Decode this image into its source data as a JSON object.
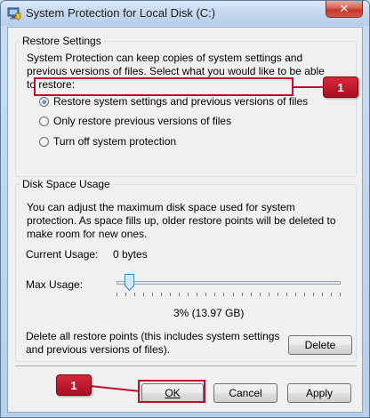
{
  "window": {
    "title": "System Protection for Local Disk (C:)",
    "close_glyph": "✕",
    "icon": "system-protection-icon"
  },
  "restore_settings": {
    "group_title": "Restore Settings",
    "description": "System Protection can keep copies of system settings and previous versions of files. Select what you would like to be able to restore:",
    "options": [
      {
        "label": "Restore system settings and previous versions of files",
        "checked": true
      },
      {
        "label": "Only restore previous versions of files",
        "checked": false
      },
      {
        "label": "Turn off system protection",
        "checked": false
      }
    ]
  },
  "disk_space": {
    "group_title": "Disk Space Usage",
    "description": "You can adjust the maximum disk space used for system protection. As space fills up, older restore points will be deleted to make room for new ones.",
    "current_usage_label": "Current Usage:",
    "current_usage_value": "0 bytes",
    "max_usage_label": "Max Usage:",
    "max_usage_value": "3% (13.97 GB)",
    "max_usage_percent": 3,
    "delete_text": "Delete all restore points (this includes system settings and previous versions of files).",
    "delete_label": "Delete"
  },
  "buttons": {
    "ok": "OK",
    "cancel": "Cancel",
    "apply": "Apply"
  },
  "callouts": {
    "first": "1",
    "second": "1"
  },
  "colors": {
    "annotation_red": "#b8132a",
    "window_frame": "#c9dcf2"
  }
}
